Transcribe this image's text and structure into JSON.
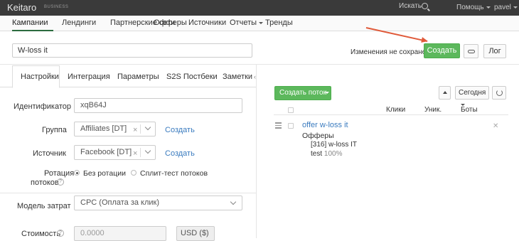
{
  "topbar": {
    "brand": "Keitaro",
    "brand_sub": "BUSINESS",
    "search_label": "Искать",
    "search_icon": "search-icon",
    "help_label": "Помощь",
    "user_label": "pavel"
  },
  "nav": {
    "items": [
      {
        "label": "Кампании",
        "active": true
      },
      {
        "label": "Лендинги"
      },
      {
        "label": "Партнерские сети"
      },
      {
        "label": "Офферы"
      },
      {
        "label": "Источники"
      },
      {
        "label": "Отчеты"
      },
      {
        "label": "Тренды"
      }
    ]
  },
  "campaign": {
    "name": "W-loss it",
    "unsaved_text": "Изменения не сохранены",
    "create_label": "Создать",
    "link_icon": "link-icon",
    "log_label": "Лог"
  },
  "tabs": [
    {
      "label": "Настройки",
      "active": true
    },
    {
      "label": "Интеграция"
    },
    {
      "label": "Параметры"
    },
    {
      "label": "S2S Постбеки"
    },
    {
      "label": "Заметки"
    }
  ],
  "form": {
    "identifier_label": "Идентификатор",
    "identifier_value": "xqB64J",
    "group_label": "Группа",
    "group_value": "Affiliates [DT]",
    "group_create": "Создать",
    "source_label": "Источник",
    "source_value": "Facebook [DT]",
    "source_create": "Создать",
    "rotation_label_1": "Ротация",
    "rotation_label_2": "потоков",
    "rotation_opt1": "Без ротации",
    "rotation_opt2": "Сплит-тест потоков",
    "cost_model_label": "Модель затрат",
    "cost_model_value": "CPC (Оплата за клик)",
    "cost_label": "Стоимость",
    "cost_value": "0.0000",
    "currency_value": "USD ($)"
  },
  "flows": {
    "create_flow_label": "Создать поток",
    "period_label": "Сегодня",
    "columns": [
      "Клики",
      "Уник.",
      "Боты"
    ],
    "rows": [
      {
        "name": "offer w-loss it",
        "offers_label": "Офферы",
        "offer_name": "[316] w-loss IT",
        "offer_sub": "test",
        "offer_pct": "100%"
      }
    ]
  },
  "colors": {
    "accent_green": "#5cb85c",
    "link_blue": "#3a7bbf",
    "annotation_arrow": "#e05a3a",
    "topbar_bg": "#3a3a3a"
  }
}
